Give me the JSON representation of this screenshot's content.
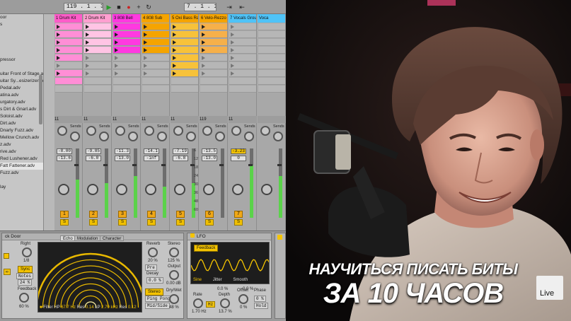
{
  "transport": {
    "tempo": "119 . 1 . 3",
    "position": "7 . 1 . 1"
  },
  "browser": {
    "items": [
      "oor",
      "s",
      "",
      "",
      "",
      "",
      "pressor",
      "",
      "uitar Front of Stage.adv",
      "uitar Sy...esizerizer.adv",
      "Pedal.adv",
      "atina.adv",
      "urgatory.adv",
      "s Dirt & Gnarl.adv",
      "Soloist.adv",
      "Dirt.adv",
      "Dnarly Fuzz.adv",
      "Mellow Crunch.adv",
      "z.adv",
      "rive.adv",
      "Red Lushener.adv",
      "Fatt Fattener.adv",
      "Fuzz.adv",
      "",
      "lay",
      ""
    ],
    "selected_index": 21
  },
  "tracks": [
    {
      "name": "1 Drum Kit",
      "color": "#ff5cc9",
      "clip_color": "#ff8ed6",
      "io": "11",
      "vol": "-8.00",
      "sub": "-13.6",
      "num": "1",
      "meter": 0.55
    },
    {
      "name": "2 Drum Kit",
      "color": "#ff9fd0",
      "clip_color": "#ffc4e4",
      "io": "11",
      "vol": "-9.85",
      "sub": "-6.0",
      "num": "2",
      "meter": 0.5
    },
    {
      "name": "3 808 Bell",
      "color": "#ff39e0",
      "clip_color": "#ff39e0",
      "io": "11",
      "vol": "-11.3",
      "sub": "-13.0",
      "num": "3",
      "meter": 0.6
    },
    {
      "name": "4 808 Sub",
      "color": "#f5a400",
      "clip_color": "#f5a400",
      "io": "11",
      "vol": "-14.1",
      "sub": "-inf",
      "num": "4",
      "meter": 0.45
    },
    {
      "name": "5 Oxi Bass Rack",
      "color": "#f5a400",
      "clip_color": "#f7c23a",
      "io": "11",
      "vol": "-7.19",
      "sub": "-6.8",
      "num": "5",
      "meter": 0.5
    },
    {
      "name": "6 Velo-Rezzo P",
      "color": "#f5a400",
      "clip_color": "#f6b04a",
      "io": "119",
      "vol": "-13.5",
      "sub": "-13.0",
      "num": "6",
      "meter": 0.0
    },
    {
      "name": "7 Vocals Group",
      "color": "#4fc3f7",
      "clip_color": "#b6b6b6",
      "io": "11",
      "vol": "-3.23",
      "sub": "0",
      "num": "7",
      "meter": 0.75
    },
    {
      "name": "Voca",
      "color": "#4fc3f7",
      "clip_color": "#b6b6b6",
      "io": "",
      "vol": "",
      "sub": "",
      "num": "",
      "meter": 0.6
    }
  ],
  "scale_labels": [
    "6",
    "12",
    "18",
    "24",
    "30",
    "36",
    "48",
    "60"
  ],
  "sends_label": "Sends",
  "solo_label": "S",
  "devices": {
    "echo": {
      "title": "ck Door",
      "tabs": [
        "Echo",
        "Modulation",
        "Character"
      ],
      "right_label": "Right",
      "right_val": "1/8",
      "sync_label": "Sync",
      "notes_label": "Notes",
      "pct_val": "24 %",
      "feedback_label": "Feedback",
      "feedback_val": "60 %",
      "filter_hp": "Filter HP",
      "filter_hp_val": "67.7 Hz",
      "res1": "Res",
      "res1_val": "0.14",
      "lp": "LP",
      "lp_val": "2.79 kHz",
      "res2_val": "0.12",
      "reverb_label": "Reverb",
      "reverb_val": "20 %",
      "pre_label": "Pre",
      "decay_label": "Decay",
      "decay_val": "0.0 %",
      "stereo_label": "Stereo",
      "stereo_val": "125 %",
      "output_label": "Output",
      "output_val": "0.00 dB",
      "dry_wet_label": "Dry/Wet",
      "dry_wet_val": "48 %",
      "stereo_btn": "Stereo",
      "ping_pong_btn": "Ping Pong",
      "mid_side_btn": "Mid/Side"
    },
    "lfo": {
      "title": "LFO",
      "feedback_btn": "Feedback",
      "wave": "Sine",
      "jitter_label": "Jitter",
      "jitter_val": "0.0 %",
      "smooth_label": "Smooth",
      "smooth_val": "0.0 %",
      "rate_label": "Rate",
      "rate_val": "1.70 Hz",
      "depth_label": "Depth",
      "depth_val": "13.7 %",
      "offset_label": "Offset",
      "offset_val": "0 %",
      "phase_label": "Phase",
      "phase_val": "0 %",
      "hold_label": "Hold",
      "hz_label": "Hz"
    }
  },
  "overlay": {
    "line1": "НАУЧИТЬСЯ ПИСАТЬ БИТЫ",
    "line2": "ЗА 10 ЧАСОВ",
    "badge": "Live"
  }
}
